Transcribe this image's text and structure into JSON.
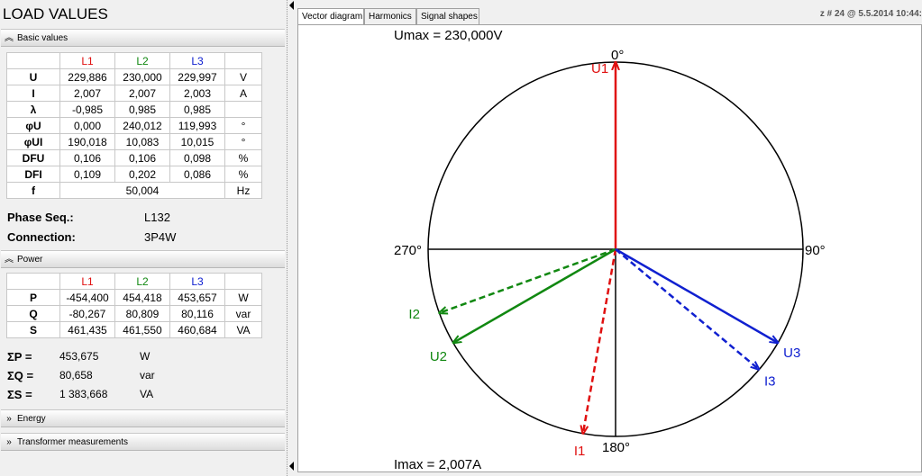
{
  "title": "LOAD VALUES",
  "basic": {
    "header": "Basic values",
    "cols": [
      "L1",
      "L2",
      "L3"
    ],
    "rows": [
      {
        "label": "U",
        "v": [
          "229,886",
          "230,000",
          "229,997"
        ],
        "unit": "V"
      },
      {
        "label": "I",
        "v": [
          "2,007",
          "2,007",
          "2,003"
        ],
        "unit": "A"
      },
      {
        "label": "λ",
        "v": [
          "-0,985",
          "0,985",
          "0,985"
        ],
        "unit": ""
      },
      {
        "label": "φU",
        "v": [
          "0,000",
          "240,012",
          "119,993"
        ],
        "unit": "°"
      },
      {
        "label": "φUI",
        "v": [
          "190,018",
          "10,083",
          "10,015"
        ],
        "unit": "°"
      },
      {
        "label": "DFU",
        "v": [
          "0,106",
          "0,106",
          "0,098"
        ],
        "unit": "%"
      },
      {
        "label": "DFI",
        "v": [
          "0,109",
          "0,202",
          "0,086"
        ],
        "unit": "%"
      }
    ],
    "f": {
      "label": "f",
      "value": "50,004",
      "unit": "Hz"
    },
    "phase_seq_label": "Phase Seq.:",
    "phase_seq_value": "L132",
    "connection_label": "Connection:",
    "connection_value": "3P4W"
  },
  "power": {
    "header": "Power",
    "cols": [
      "L1",
      "L2",
      "L3"
    ],
    "rows": [
      {
        "label": "P",
        "v": [
          "-454,400",
          "454,418",
          "453,657"
        ],
        "unit": "W"
      },
      {
        "label": "Q",
        "v": [
          "-80,267",
          "80,809",
          "80,116"
        ],
        "unit": "var"
      },
      {
        "label": "S",
        "v": [
          "461,435",
          "461,550",
          "460,684"
        ],
        "unit": "VA"
      }
    ],
    "totals": [
      {
        "label": "ΣP =",
        "value": "453,675",
        "unit": "W"
      },
      {
        "label": "ΣQ =",
        "value": "80,658",
        "unit": "var"
      },
      {
        "label": "ΣS =",
        "value": "1 383,668",
        "unit": "VA"
      }
    ]
  },
  "sections": [
    "Energy",
    "Transformer measurements"
  ],
  "tabs": [
    "Vector diagram",
    "Harmonics",
    "Signal shapes"
  ],
  "status": "z # 24 @ 5.5.2014 10:44:",
  "diagram": {
    "umax": "Umax = 230,000V",
    "imax": "Imax = 2,007A",
    "angle_labels": [
      "0°",
      "90°",
      "180°",
      "270°"
    ],
    "colors": {
      "L1": "#e01010",
      "L2": "#118811",
      "L3": "#1020d0"
    },
    "voltage_vectors": [
      {
        "name": "U1",
        "angle_deg": 0,
        "magnitude": 230.0
      },
      {
        "name": "U2",
        "angle_deg": 240.012,
        "magnitude": 230.0
      },
      {
        "name": "U3",
        "angle_deg": 119.993,
        "magnitude": 229.997
      }
    ],
    "current_vectors": [
      {
        "name": "I1",
        "angle_deg": 190.018,
        "magnitude": 2.007
      },
      {
        "name": "I2",
        "angle_deg": 250.095,
        "magnitude": 2.007
      },
      {
        "name": "I3",
        "angle_deg": 130.008,
        "magnitude": 2.003
      }
    ]
  }
}
